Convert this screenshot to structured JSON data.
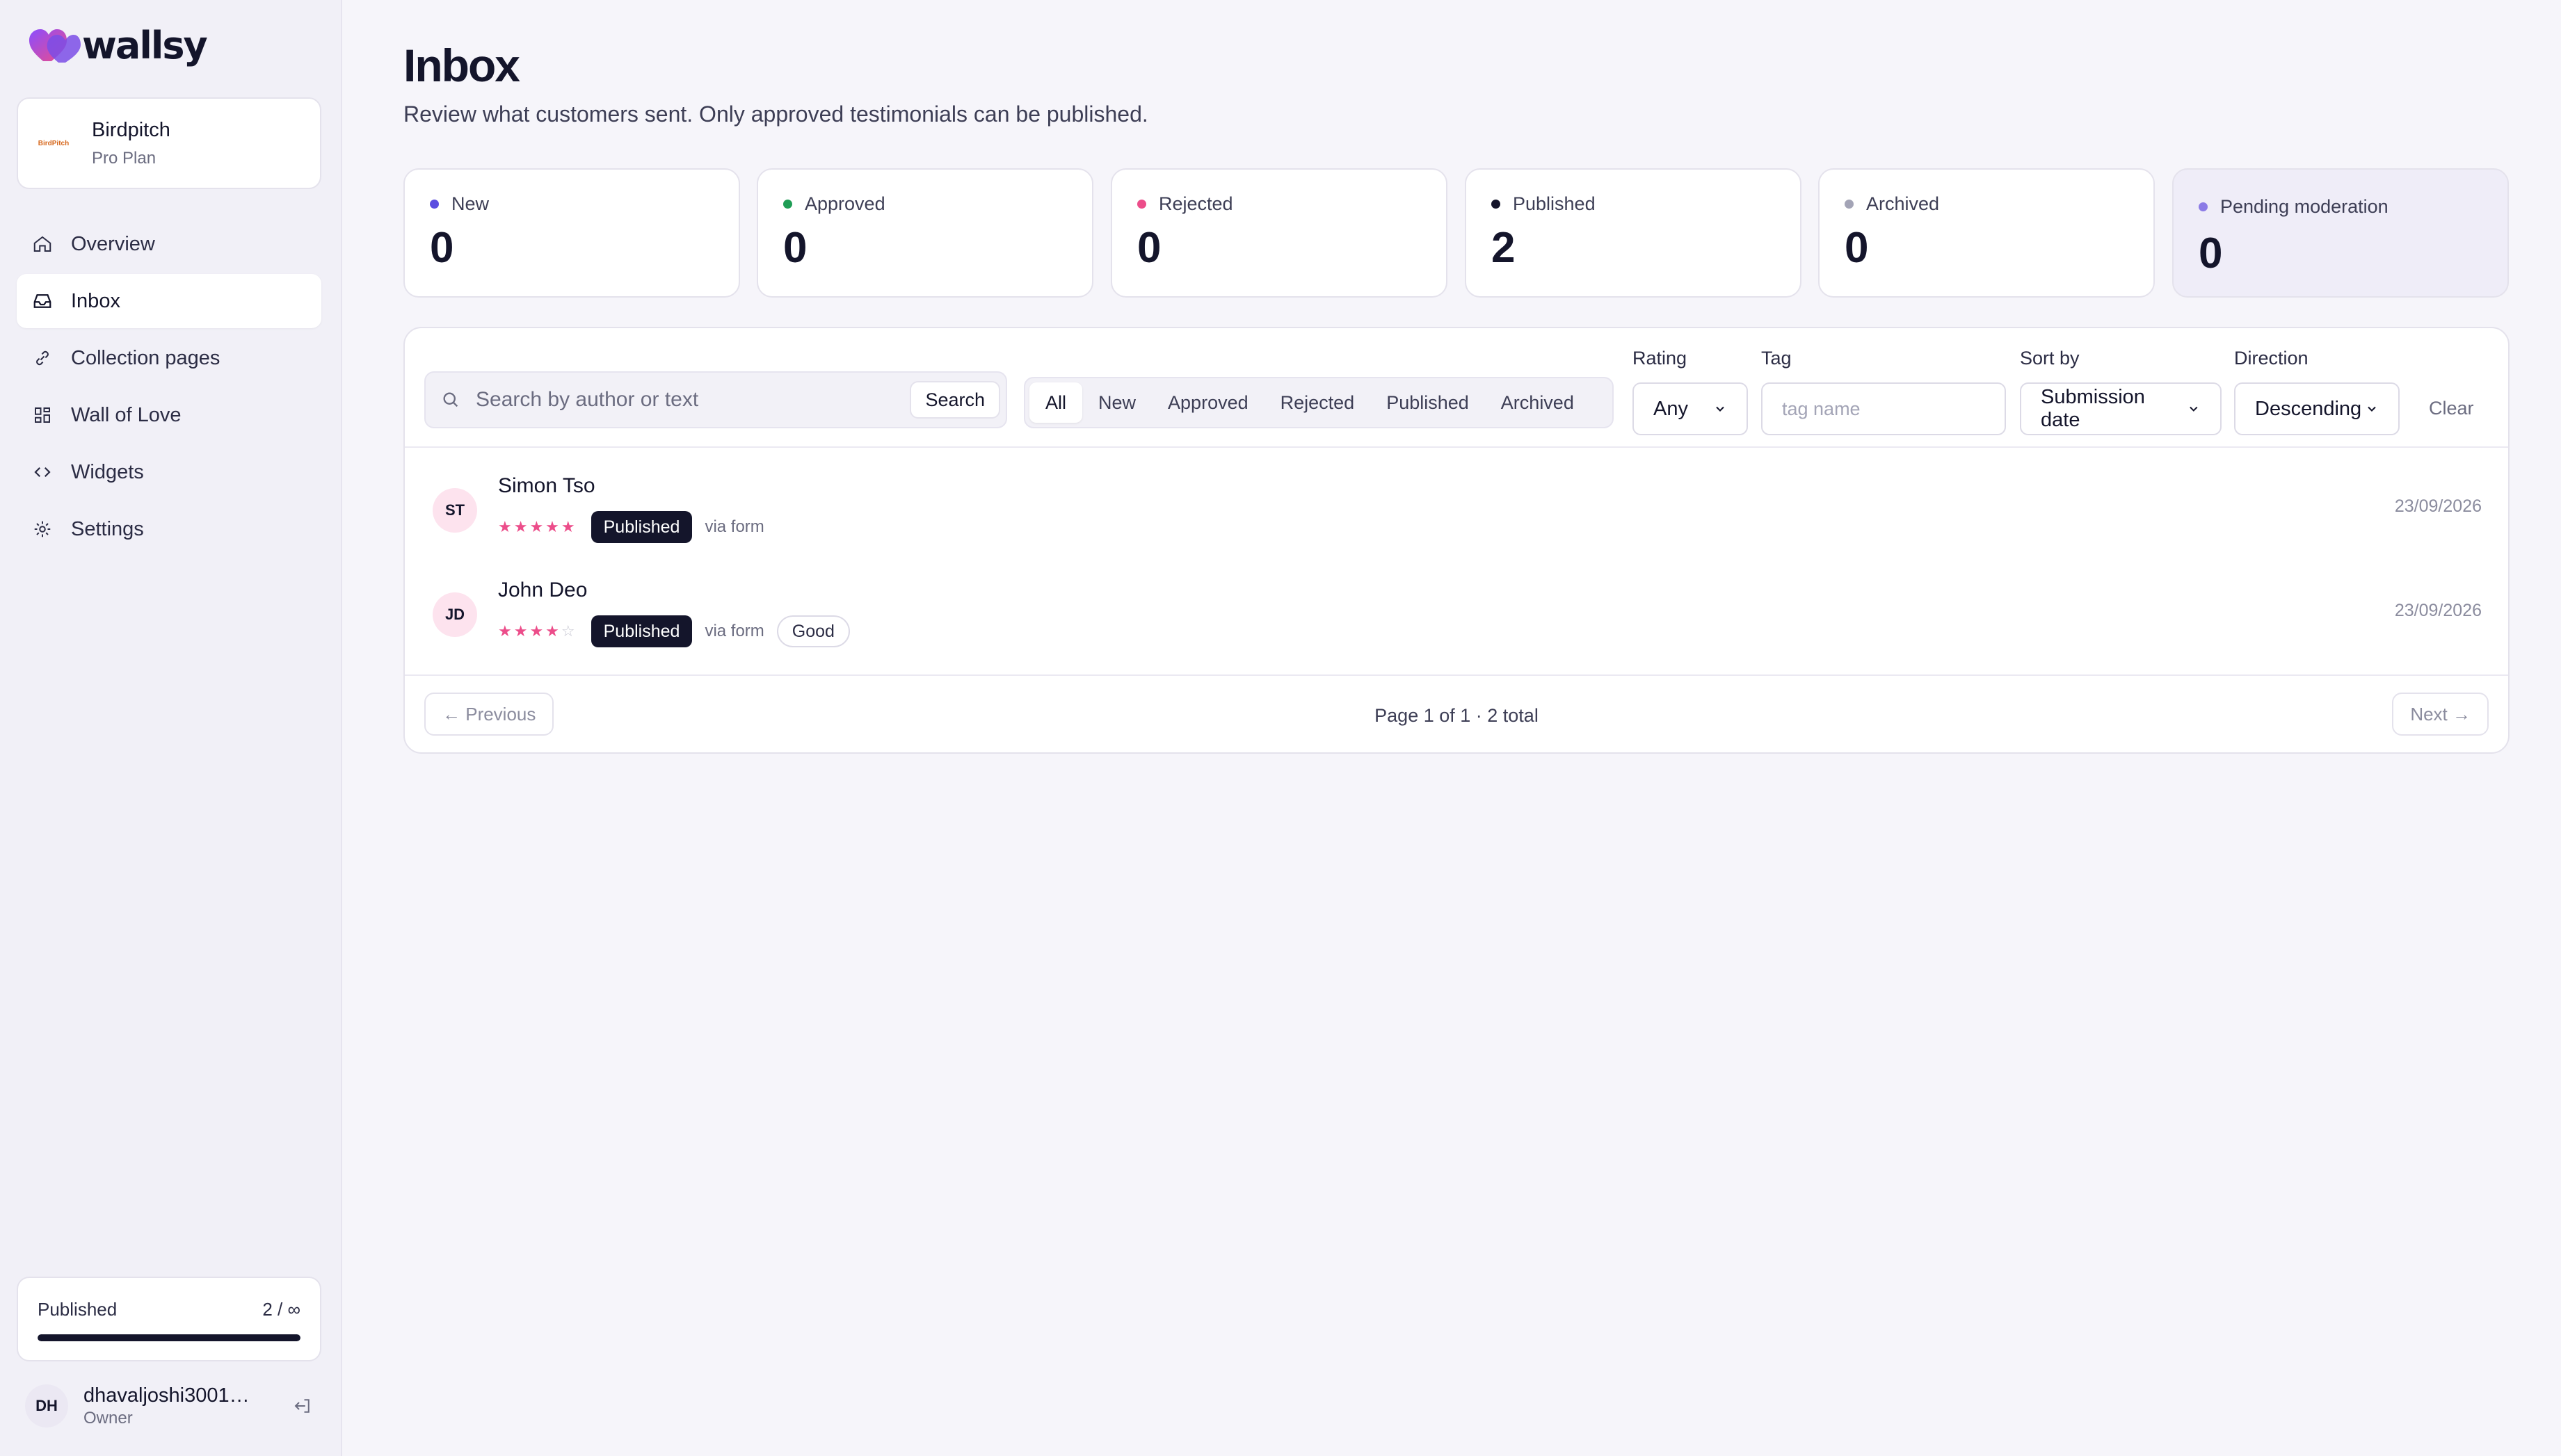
{
  "app": {
    "name": "wallsy"
  },
  "workspace": {
    "name": "Birdpitch",
    "plan": "Pro Plan",
    "logo_text": "BirdPitch"
  },
  "nav": {
    "items": [
      {
        "label": "Overview",
        "icon": "home-icon",
        "active": false
      },
      {
        "label": "Inbox",
        "icon": "inbox-icon",
        "active": true
      },
      {
        "label": "Collection pages",
        "icon": "link-icon",
        "active": false
      },
      {
        "label": "Wall of Love",
        "icon": "grid-icon",
        "active": false
      },
      {
        "label": "Widgets",
        "icon": "code-icon",
        "active": false
      },
      {
        "label": "Settings",
        "icon": "gear-icon",
        "active": false
      }
    ]
  },
  "usage": {
    "label": "Published",
    "value": "2 / ∞",
    "fill_fraction": 1.0
  },
  "user": {
    "initials": "DH",
    "email": "dhavaljoshi3001@...",
    "role": "Owner"
  },
  "page": {
    "title": "Inbox",
    "subtitle": "Review what customers sent. Only approved testimonials can be published."
  },
  "stats": [
    {
      "label": "New",
      "value": "0",
      "color": "#5b4de0"
    },
    {
      "label": "Approved",
      "value": "0",
      "color": "#1f9d55"
    },
    {
      "label": "Rejected",
      "value": "0",
      "color": "#ec4d8a"
    },
    {
      "label": "Published",
      "value": "2",
      "color": "#14152b"
    },
    {
      "label": "Archived",
      "value": "0",
      "color": "#a3a4b6"
    },
    {
      "label": "Pending moderation",
      "value": "0",
      "color": "#8b7be6"
    }
  ],
  "search": {
    "placeholder": "Search by author or text",
    "value": "",
    "button": "Search"
  },
  "tabs": [
    "All",
    "New",
    "Approved",
    "Rejected",
    "Published",
    "Archived"
  ],
  "filters": {
    "rating": {
      "label": "Rating",
      "value": "Any"
    },
    "tag": {
      "label": "Tag",
      "placeholder": "tag name"
    },
    "sort_by": {
      "label": "Sort by",
      "value": "Submission date"
    },
    "direction": {
      "label": "Direction",
      "value": "Descending"
    },
    "clear": "Clear"
  },
  "rows": [
    {
      "initials": "ST",
      "author": "Simon Tso",
      "rating": 5,
      "status": "Published",
      "source": "via form",
      "tag": "",
      "date": "23/09/2026"
    },
    {
      "initials": "JD",
      "author": "John Deo",
      "rating": 4,
      "status": "Published",
      "source": "via form",
      "tag": "Good",
      "date": "23/09/2026"
    }
  ],
  "pagination": {
    "prev": "← Previous",
    "info": "Page 1 of 1 · 2 total",
    "next": "Next →"
  },
  "colors": {
    "accent": "#14152b",
    "star": "#ec4d8a",
    "brand_heart": "#7b4de6"
  }
}
